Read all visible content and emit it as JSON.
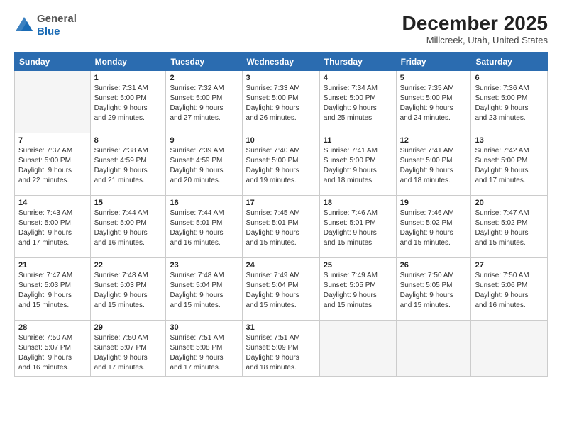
{
  "logo": {
    "general": "General",
    "blue": "Blue"
  },
  "title": "December 2025",
  "location": "Millcreek, Utah, United States",
  "days_of_week": [
    "Sunday",
    "Monday",
    "Tuesday",
    "Wednesday",
    "Thursday",
    "Friday",
    "Saturday"
  ],
  "weeks": [
    [
      {
        "day": "",
        "info": ""
      },
      {
        "day": "1",
        "info": "Sunrise: 7:31 AM\nSunset: 5:00 PM\nDaylight: 9 hours\nand 29 minutes."
      },
      {
        "day": "2",
        "info": "Sunrise: 7:32 AM\nSunset: 5:00 PM\nDaylight: 9 hours\nand 27 minutes."
      },
      {
        "day": "3",
        "info": "Sunrise: 7:33 AM\nSunset: 5:00 PM\nDaylight: 9 hours\nand 26 minutes."
      },
      {
        "day": "4",
        "info": "Sunrise: 7:34 AM\nSunset: 5:00 PM\nDaylight: 9 hours\nand 25 minutes."
      },
      {
        "day": "5",
        "info": "Sunrise: 7:35 AM\nSunset: 5:00 PM\nDaylight: 9 hours\nand 24 minutes."
      },
      {
        "day": "6",
        "info": "Sunrise: 7:36 AM\nSunset: 5:00 PM\nDaylight: 9 hours\nand 23 minutes."
      }
    ],
    [
      {
        "day": "7",
        "info": "Sunrise: 7:37 AM\nSunset: 5:00 PM\nDaylight: 9 hours\nand 22 minutes."
      },
      {
        "day": "8",
        "info": "Sunrise: 7:38 AM\nSunset: 4:59 PM\nDaylight: 9 hours\nand 21 minutes."
      },
      {
        "day": "9",
        "info": "Sunrise: 7:39 AM\nSunset: 4:59 PM\nDaylight: 9 hours\nand 20 minutes."
      },
      {
        "day": "10",
        "info": "Sunrise: 7:40 AM\nSunset: 5:00 PM\nDaylight: 9 hours\nand 19 minutes."
      },
      {
        "day": "11",
        "info": "Sunrise: 7:41 AM\nSunset: 5:00 PM\nDaylight: 9 hours\nand 18 minutes."
      },
      {
        "day": "12",
        "info": "Sunrise: 7:41 AM\nSunset: 5:00 PM\nDaylight: 9 hours\nand 18 minutes."
      },
      {
        "day": "13",
        "info": "Sunrise: 7:42 AM\nSunset: 5:00 PM\nDaylight: 9 hours\nand 17 minutes."
      }
    ],
    [
      {
        "day": "14",
        "info": "Sunrise: 7:43 AM\nSunset: 5:00 PM\nDaylight: 9 hours\nand 17 minutes."
      },
      {
        "day": "15",
        "info": "Sunrise: 7:44 AM\nSunset: 5:00 PM\nDaylight: 9 hours\nand 16 minutes."
      },
      {
        "day": "16",
        "info": "Sunrise: 7:44 AM\nSunset: 5:01 PM\nDaylight: 9 hours\nand 16 minutes."
      },
      {
        "day": "17",
        "info": "Sunrise: 7:45 AM\nSunset: 5:01 PM\nDaylight: 9 hours\nand 15 minutes."
      },
      {
        "day": "18",
        "info": "Sunrise: 7:46 AM\nSunset: 5:01 PM\nDaylight: 9 hours\nand 15 minutes."
      },
      {
        "day": "19",
        "info": "Sunrise: 7:46 AM\nSunset: 5:02 PM\nDaylight: 9 hours\nand 15 minutes."
      },
      {
        "day": "20",
        "info": "Sunrise: 7:47 AM\nSunset: 5:02 PM\nDaylight: 9 hours\nand 15 minutes."
      }
    ],
    [
      {
        "day": "21",
        "info": "Sunrise: 7:47 AM\nSunset: 5:03 PM\nDaylight: 9 hours\nand 15 minutes."
      },
      {
        "day": "22",
        "info": "Sunrise: 7:48 AM\nSunset: 5:03 PM\nDaylight: 9 hours\nand 15 minutes."
      },
      {
        "day": "23",
        "info": "Sunrise: 7:48 AM\nSunset: 5:04 PM\nDaylight: 9 hours\nand 15 minutes."
      },
      {
        "day": "24",
        "info": "Sunrise: 7:49 AM\nSunset: 5:04 PM\nDaylight: 9 hours\nand 15 minutes."
      },
      {
        "day": "25",
        "info": "Sunrise: 7:49 AM\nSunset: 5:05 PM\nDaylight: 9 hours\nand 15 minutes."
      },
      {
        "day": "26",
        "info": "Sunrise: 7:50 AM\nSunset: 5:05 PM\nDaylight: 9 hours\nand 15 minutes."
      },
      {
        "day": "27",
        "info": "Sunrise: 7:50 AM\nSunset: 5:06 PM\nDaylight: 9 hours\nand 16 minutes."
      }
    ],
    [
      {
        "day": "28",
        "info": "Sunrise: 7:50 AM\nSunset: 5:07 PM\nDaylight: 9 hours\nand 16 minutes."
      },
      {
        "day": "29",
        "info": "Sunrise: 7:50 AM\nSunset: 5:07 PM\nDaylight: 9 hours\nand 17 minutes."
      },
      {
        "day": "30",
        "info": "Sunrise: 7:51 AM\nSunset: 5:08 PM\nDaylight: 9 hours\nand 17 minutes."
      },
      {
        "day": "31",
        "info": "Sunrise: 7:51 AM\nSunset: 5:09 PM\nDaylight: 9 hours\nand 18 minutes."
      },
      {
        "day": "",
        "info": ""
      },
      {
        "day": "",
        "info": ""
      },
      {
        "day": "",
        "info": ""
      }
    ]
  ]
}
